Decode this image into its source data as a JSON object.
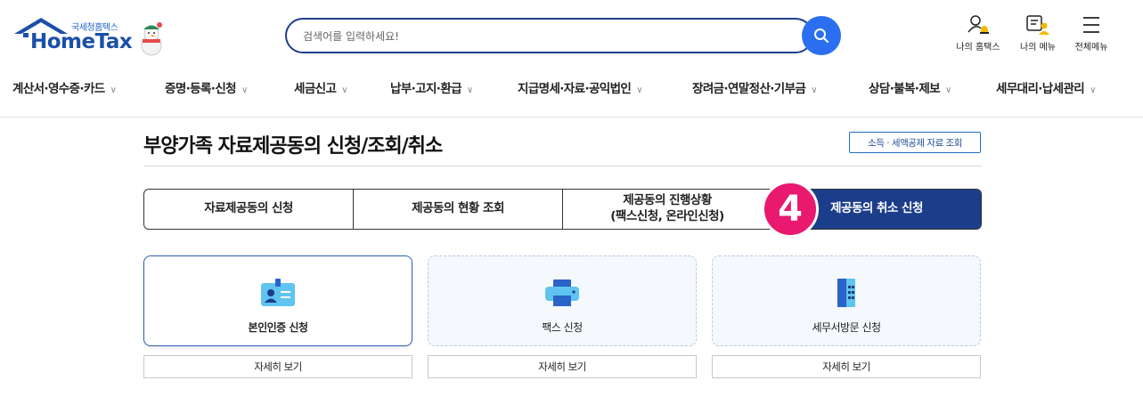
{
  "logo": {
    "sub": "국세청홈택스",
    "main": "HomeTax"
  },
  "search": {
    "placeholder": "검색어를 입력하세요!"
  },
  "util": {
    "my_hometax": "나의 홈택스",
    "my_menu": "나의 메뉴",
    "all_menu": "전체메뉴"
  },
  "nav": [
    "계산서·영수증·카드",
    "증명·등록·신청",
    "세금신고",
    "납부·고지·환급",
    "지급명세·자료·공익법인",
    "장려금·연말정산·기부금",
    "상담·불복·제보",
    "세무대리·납세관리"
  ],
  "page": {
    "title": "부양가족 자료제공동의 신청/조회/취소",
    "lookup_button": "소득 · 세액공제 자료 조회"
  },
  "tabs": [
    {
      "line1": "자료제공동의 신청",
      "line2": ""
    },
    {
      "line1": "제공동의 현황 조회",
      "line2": ""
    },
    {
      "line1": "제공동의 진행상황",
      "line2": "(팩스신청, 온라인신청)"
    },
    {
      "line1": "제공동의 취소 신청",
      "line2": ""
    }
  ],
  "active_tab": 3,
  "step_badge": "4",
  "cards": [
    {
      "label": "본인인증 신청",
      "icon": "id-card-icon",
      "more": "자세히 보기"
    },
    {
      "label": "팩스 신청",
      "icon": "printer-icon",
      "more": "자세히 보기"
    },
    {
      "label": "세무서방문 신청",
      "icon": "building-icon",
      "more": "자세히 보기"
    }
  ],
  "colors": {
    "primary": "#1c3d8a",
    "accent_blue": "#2b6ff0",
    "badge": "#e8196f"
  }
}
